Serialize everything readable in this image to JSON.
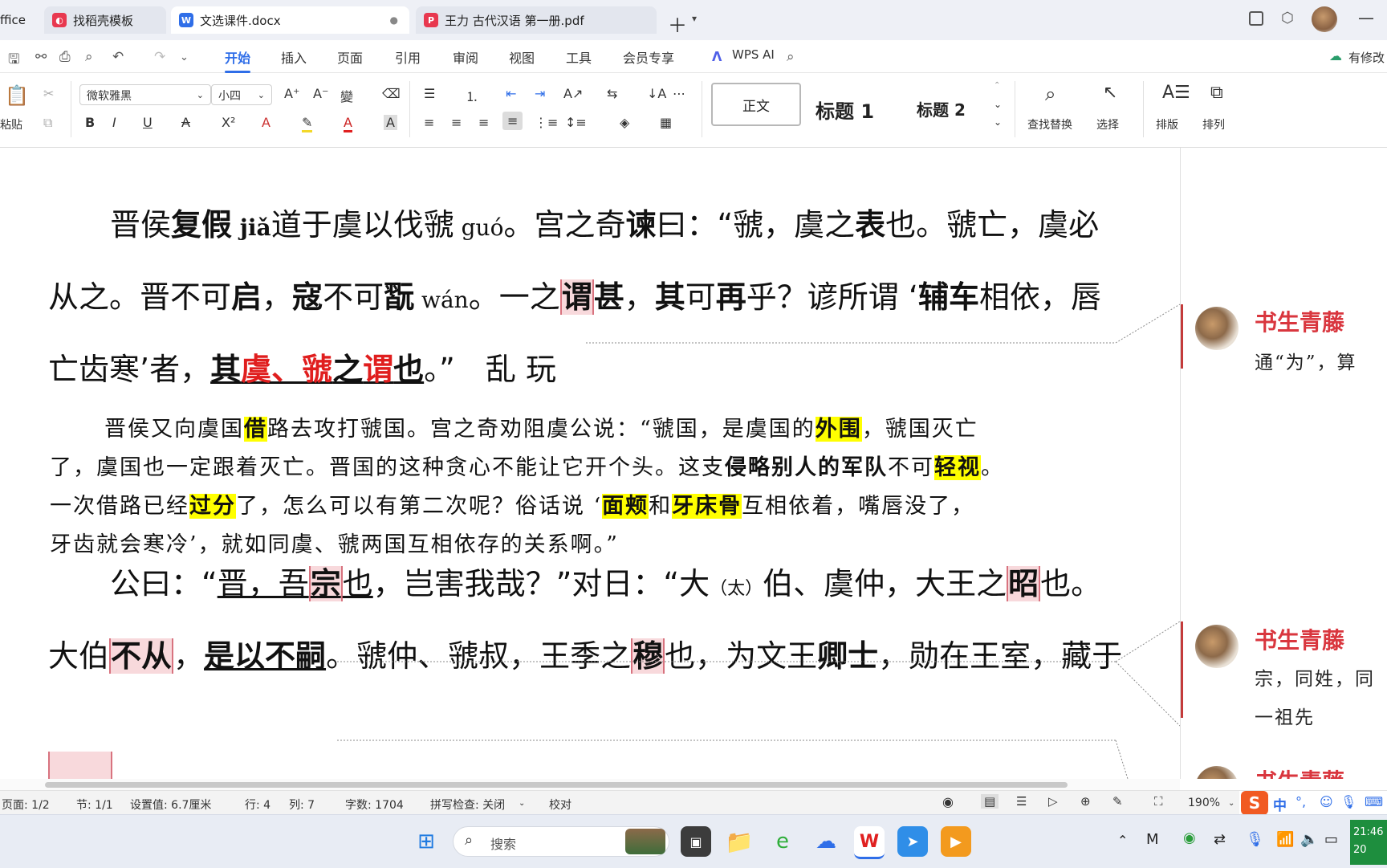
{
  "tabs": [
    {
      "label": "ffice",
      "icon": "office-icon"
    },
    {
      "label": "找稻壳模板",
      "icon": "docer-icon"
    },
    {
      "label": "文选课件.docx",
      "icon": "word-icon",
      "active": true
    },
    {
      "label": "王力 古代汉语 第一册.pdf",
      "icon": "pdf-icon"
    }
  ],
  "ribbon_nav": [
    "开始",
    "插入",
    "页面",
    "引用",
    "审阅",
    "视图",
    "工具",
    "会员专享"
  ],
  "wps_ai": "WPS AI",
  "modify_label": "有修改",
  "toolbar": {
    "paste": "粘贴",
    "font": "微软雅黑",
    "size": "小四",
    "style_normal": "正文",
    "style_h1": "标题 1",
    "style_h2": "标题 2",
    "find_replace": "查找替换",
    "select": "选择",
    "layout": "排版",
    "arrange": "排列"
  },
  "doc": {
    "p1_l1": [
      "晋侯",
      "复假",
      " jiǎ",
      "道于虞以伐虢",
      " guó",
      "。宫之奇",
      "谏",
      "曰：“虢，虞之",
      "表",
      "也。虢亡，虞必"
    ],
    "p1_l2": [
      "从之。晋不可",
      "启",
      "，",
      "寇",
      "不可",
      "翫",
      " wán",
      "。一之",
      "谓",
      "甚",
      "，",
      "其",
      "可",
      "再",
      "乎？谚所谓 ‘",
      "辅车",
      "相依，唇"
    ],
    "p1_l3": [
      "亡齿寒’者，",
      "其",
      "虞、虢",
      "之",
      "谓",
      "也",
      "。”　乱 玩"
    ],
    "t1_l1": [
      "晋侯又向虞国",
      "借",
      "路去攻打虢国。宫之奇劝阻虞公说：“虢国，是虞国的",
      "外围",
      "，虢国灭亡"
    ],
    "t1_l2": [
      "了，虞国也一定跟着灭亡。晋国的这种贪心不能让它开个头。这支",
      "侵略别人的军队",
      "不可",
      "轻视",
      "。"
    ],
    "t1_l3": [
      "一次借路已经",
      "过分",
      "了，怎么可以有第二次呢？俗话说 ‘",
      "面颊",
      "和",
      "牙床骨",
      "互相依着，嘴唇没了，"
    ],
    "t1_l4": "牙齿就会寒冷’，就如同虞、虢两国互相依存的关系啊。”",
    "p2_l1": [
      "公曰：“",
      "晋，吾",
      "宗",
      "也",
      "，岂害我哉？”对日：“大",
      "（太）",
      "伯、虞仲，大王之",
      "昭",
      "也。"
    ],
    "p2_l2": [
      "大伯",
      "不从",
      "，",
      "是以不嗣",
      "。虢仲、虢叔，王季之",
      "穆",
      "也，为文王",
      "卿士",
      "，勋在王室，藏于"
    ]
  },
  "comments": [
    {
      "author": "书生青藤",
      "text": "通“为”，算"
    },
    {
      "author": "书生青藤",
      "text": "宗，同姓，同",
      "text2": "一祖先"
    },
    {
      "author": "书生青藤",
      "text": ""
    }
  ],
  "status": {
    "page": "页面: 1/2",
    "section": "节: 1/1",
    "setting": "设置值: 6.7厘米",
    "row": "行: 4",
    "col": "列: 7",
    "words": "字数: 1704",
    "spell": "拼写检查: 关闭",
    "proof": "校对",
    "zoom": "190%"
  },
  "taskbar": {
    "search_placeholder": "搜索",
    "time": "21:46",
    "date": "20",
    "ime": "中"
  }
}
